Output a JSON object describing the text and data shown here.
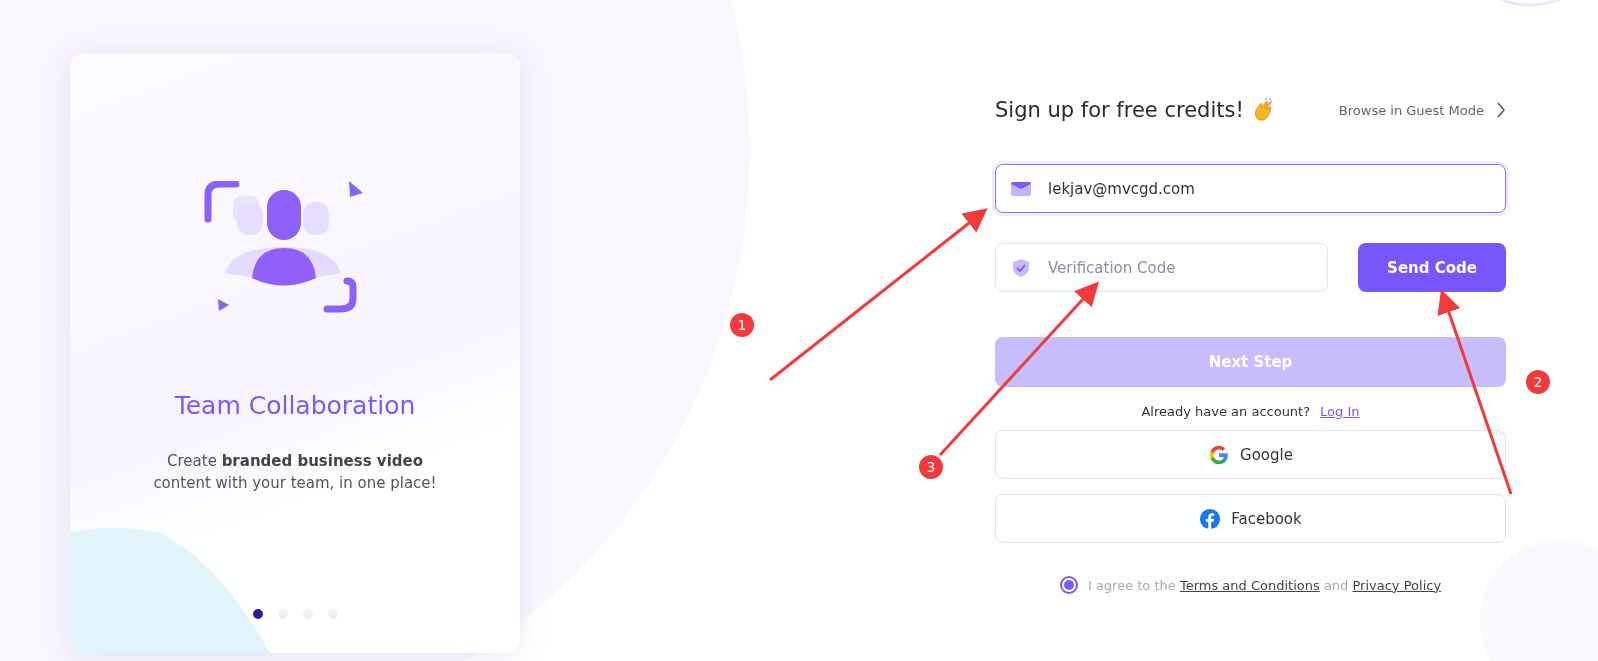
{
  "slide": {
    "title": "Team Collaboration",
    "description": "Create **branded business video** content with your team, in one place!",
    "dots": [
      {
        "selected": true
      },
      {
        "selected": false
      },
      {
        "selected": false
      },
      {
        "selected": false
      }
    ]
  },
  "form": {
    "title": "Sign up for free credits!",
    "guest_link": "Browse in Guest Mode",
    "email": {
      "value": "lekjav@mvcgd.com",
      "focused": true
    },
    "code": {
      "placeholder": "Verification Code"
    },
    "send_button": "Send Code",
    "next_button": {
      "label": "Next Step",
      "disabled": true
    },
    "login_prompt": "Already have an account?",
    "login_link": "Log In",
    "social": [
      {
        "kind": "google",
        "label": "Google"
      },
      {
        "kind": "facebook",
        "label": "Facebook"
      }
    ],
    "agreement": {
      "checked": true,
      "text_before": "I agree to the",
      "terms": "Terms and Conditions",
      "joiner": "and",
      "privacy": "Privacy Policy"
    }
  },
  "annotations": [
    {
      "label": "1"
    },
    {
      "label": "2"
    },
    {
      "label": "3"
    }
  ]
}
